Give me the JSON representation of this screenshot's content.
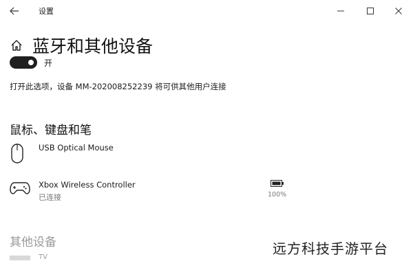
{
  "window": {
    "title": "设置",
    "back_icon": "back-arrow-icon",
    "minimize_icon": "minimize-icon",
    "maximize_icon": "maximize-icon",
    "close_icon": "close-icon"
  },
  "page": {
    "title": "蓝牙和其他设备",
    "home_icon": "home-icon"
  },
  "bluetooth": {
    "toggle_state": "on",
    "toggle_label": "开",
    "discover_text": "打开此选项，设备 MM-202008252239 将可供其他用户连接"
  },
  "mouse_section": {
    "title": "鼠标、键盘和笔",
    "devices": [
      {
        "name": "USB Optical Mouse",
        "icon": "mouse-icon"
      },
      {
        "name": "Xbox Wireless Controller",
        "status": "已连接",
        "icon": "gamepad-icon",
        "battery_icon": "battery-icon",
        "battery": "100%"
      }
    ]
  },
  "other_section": {
    "title": "其他设备",
    "partial_item": "TV"
  },
  "watermark": "远方科技手游平台"
}
